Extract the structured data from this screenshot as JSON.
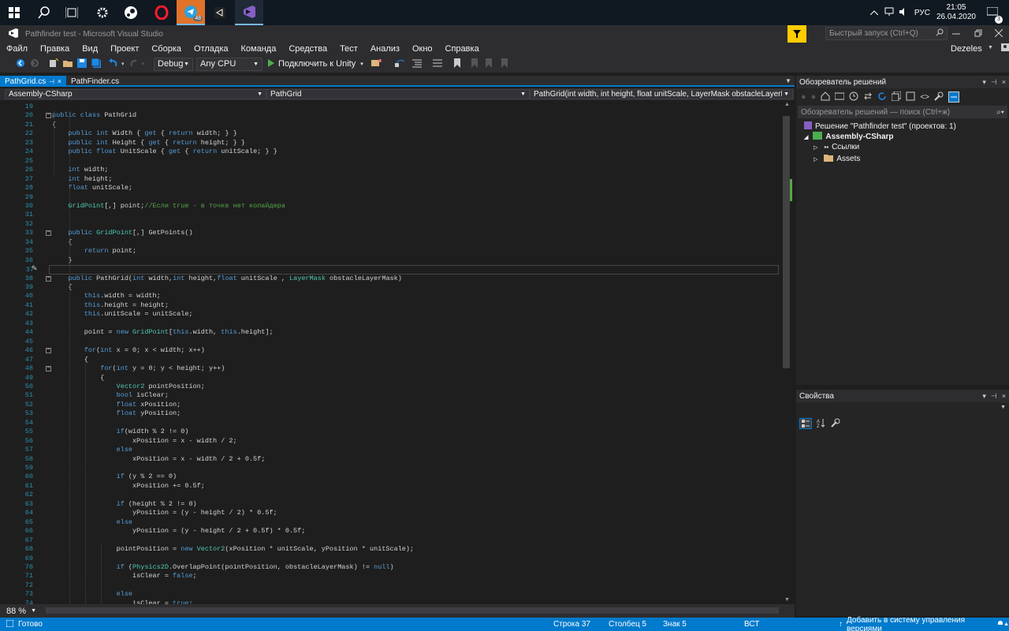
{
  "taskbar": {
    "tray_lang": "РУС",
    "time": "21:05",
    "date": "26.04.2020",
    "telegram_badge": "48",
    "notif_count": "3"
  },
  "window": {
    "title": "Pathfinder test - Microsoft Visual Studio",
    "quick_launch_placeholder": "Быстрый запуск (Ctrl+Q)",
    "user": "Dezeles"
  },
  "menu": [
    "Файл",
    "Правка",
    "Вид",
    "Проект",
    "Сборка",
    "Отладка",
    "Команда",
    "Средства",
    "Тест",
    "Анализ",
    "Окно",
    "Справка"
  ],
  "toolbar": {
    "config": "Debug",
    "platform": "Any CPU",
    "attach": "Подключить к Unity"
  },
  "tabs": [
    {
      "label": "PathGrid.cs",
      "active": true
    },
    {
      "label": "PathFinder.cs",
      "active": false
    }
  ],
  "nav": {
    "project": "Assembly-CSharp",
    "type": "PathGrid",
    "member": "PathGrid(int width, int height, float unitScale, LayerMask obstacleLayerMask)"
  },
  "code": [
    {
      "n": "19",
      "t": ""
    },
    {
      "n": "20",
      "t": "public class PathGrid"
    },
    {
      "n": "21",
      "t": "{"
    },
    {
      "n": "22",
      "t": "    public int Width { get { return width; } }"
    },
    {
      "n": "23",
      "t": "    public int Height { get { return height; } }"
    },
    {
      "n": "24",
      "t": "    public float UnitScale { get { return unitScale; } }"
    },
    {
      "n": "25",
      "t": ""
    },
    {
      "n": "26",
      "t": "    int width;"
    },
    {
      "n": "27",
      "t": "    int height;"
    },
    {
      "n": "28",
      "t": "    float unitScale;"
    },
    {
      "n": "29",
      "t": ""
    },
    {
      "n": "30",
      "t": "    GridPoint[,] point;//Если true - в точке нет колайдера"
    },
    {
      "n": "31",
      "t": ""
    },
    {
      "n": "32",
      "t": ""
    },
    {
      "n": "33",
      "t": "    public GridPoint[,] GetPoints()"
    },
    {
      "n": "34",
      "t": "    {"
    },
    {
      "n": "35",
      "t": "        return point;"
    },
    {
      "n": "36",
      "t": "    }"
    },
    {
      "n": "37",
      "t": ""
    },
    {
      "n": "38",
      "t": "    public PathGrid(int width,int height,float unitScale , LayerMask obstacleLayerMask)"
    },
    {
      "n": "39",
      "t": "    {"
    },
    {
      "n": "40",
      "t": "        this.width = width;"
    },
    {
      "n": "41",
      "t": "        this.height = height;"
    },
    {
      "n": "42",
      "t": "        this.unitScale = unitScale;"
    },
    {
      "n": "43",
      "t": ""
    },
    {
      "n": "44",
      "t": "        point = new GridPoint[this.width, this.height];"
    },
    {
      "n": "45",
      "t": ""
    },
    {
      "n": "46",
      "t": "        for(int x = 0; x < width; x++)"
    },
    {
      "n": "47",
      "t": "        {"
    },
    {
      "n": "48",
      "t": "            for(int y = 0; y < height; y++)"
    },
    {
      "n": "49",
      "t": "            {"
    },
    {
      "n": "50",
      "t": "                Vector2 pointPosition;"
    },
    {
      "n": "51",
      "t": "                bool isClear;"
    },
    {
      "n": "52",
      "t": "                float xPosition;"
    },
    {
      "n": "53",
      "t": "                float yPosition;"
    },
    {
      "n": "54",
      "t": ""
    },
    {
      "n": "55",
      "t": "                if(width % 2 != 0)"
    },
    {
      "n": "56",
      "t": "                    xPosition = x - width / 2;"
    },
    {
      "n": "57",
      "t": "                else"
    },
    {
      "n": "58",
      "t": "                    xPosition = x - width / 2 + 0.5f;"
    },
    {
      "n": "59",
      "t": ""
    },
    {
      "n": "60",
      "t": "                if (y % 2 == 0)"
    },
    {
      "n": "61",
      "t": "                    xPosition += 0.5f;"
    },
    {
      "n": "62",
      "t": ""
    },
    {
      "n": "63",
      "t": "                if (height % 2 != 0)"
    },
    {
      "n": "64",
      "t": "                    yPosition = (y - height / 2) * 0.5f;"
    },
    {
      "n": "65",
      "t": "                else"
    },
    {
      "n": "66",
      "t": "                    yPosition = (y - height / 2 + 0.5f) * 0.5f;"
    },
    {
      "n": "67",
      "t": ""
    },
    {
      "n": "68",
      "t": "                pointPosition = new Vector2(xPosition * unitScale, yPosition * unitScale);"
    },
    {
      "n": "69",
      "t": ""
    },
    {
      "n": "70",
      "t": "                if (Physics2D.OverlapPoint(pointPosition, obstacleLayerMask) != null)"
    },
    {
      "n": "71",
      "t": "                    isClear = false;"
    },
    {
      "n": "72",
      "t": ""
    },
    {
      "n": "73",
      "t": "                else"
    },
    {
      "n": "74",
      "t": "                    isClear = true;"
    }
  ],
  "zoom": "88 %",
  "solution_explorer": {
    "title": "Обозреватель решений",
    "search_placeholder": "Обозреватель решений — поиск (Ctrl+ж)",
    "solution": "Решение \"Pathfinder test\"  (проектов: 1)",
    "project": "Assembly-CSharp",
    "refs": "Ссылки",
    "assets": "Assets"
  },
  "properties": {
    "title": "Свойства"
  },
  "status": {
    "ready": "Готово",
    "row": "Строка 37",
    "col": "Столбец 5",
    "char": "Знак 5",
    "mode": "ВСТ",
    "vcs": "Добавить в систему управления версиями"
  }
}
